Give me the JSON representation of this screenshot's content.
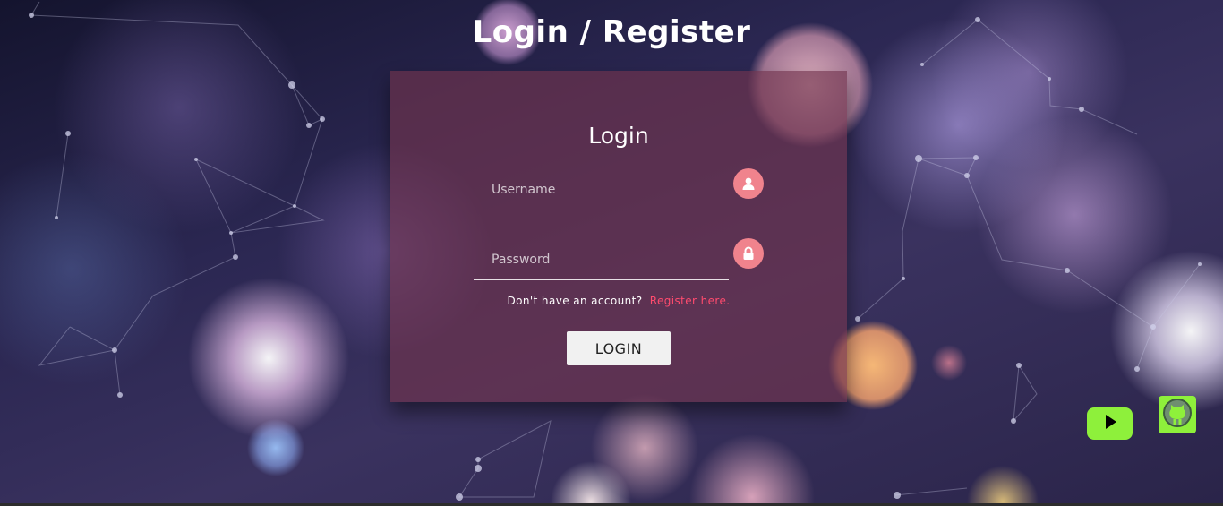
{
  "header": {
    "title": "Login / Register"
  },
  "login_form": {
    "title": "Login",
    "username": {
      "placeholder": "Username",
      "value": "",
      "icon": "user-icon"
    },
    "password": {
      "placeholder": "Password",
      "value": "",
      "icon": "lock-icon"
    },
    "signup_prompt": "Don't have an account?",
    "signup_link": "Register here.",
    "submit_label": "LOGIN"
  },
  "social": {
    "youtube_icon": "youtube-icon",
    "github_icon": "github-icon"
  },
  "colors": {
    "card_bg": "#70344e",
    "icon_circle": "#f0838d",
    "link": "#ff4b6e",
    "social_bg": "#8ef03b",
    "button_bg": "#f1f1f1"
  }
}
